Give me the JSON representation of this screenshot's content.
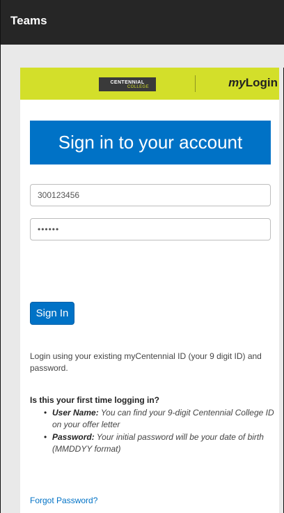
{
  "window": {
    "title": "Teams"
  },
  "brand": {
    "logo_top": "CENTENNIAL",
    "logo_bottom": "COLLEGE",
    "product_my": "my",
    "product_login": "Login",
    "bar_color": "#d3df2a"
  },
  "login": {
    "heading": "Sign in to your account",
    "username_value": "300123456",
    "password_value": "••••••",
    "signin_label": "Sign In",
    "accent_color": "#0072c6"
  },
  "help": {
    "intro": "Login using your existing myCentennial ID (your 9 digit ID) and password.",
    "first_time_heading": "Is this your first time logging in?",
    "items": [
      {
        "label": "User Name:",
        "text": " You can find your 9-digit Centennial College ID on your offer letter"
      },
      {
        "label": "Password:",
        "text": " Your initial password will be your date of birth (MMDDYY format)"
      }
    ],
    "bullet_glyph": "•"
  },
  "links": {
    "forgot_password": "Forgot Password?"
  }
}
